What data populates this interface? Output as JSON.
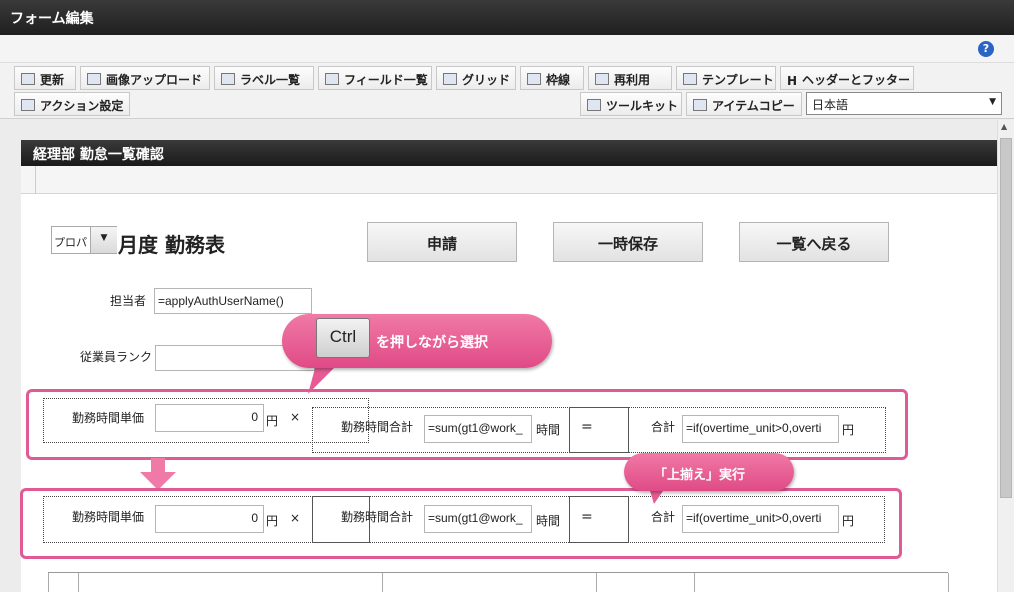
{
  "window": {
    "title": "フォーム編集"
  },
  "help": {
    "icon": "help-icon"
  },
  "toolbar": {
    "row1": [
      {
        "label": "更新",
        "icon": "refresh-icon"
      },
      {
        "label": "画像アップロード",
        "icon": "image-upload-icon"
      },
      {
        "label": "ラベル一覧",
        "icon": "label-list-icon"
      },
      {
        "label": "フィールド一覧",
        "icon": "field-list-icon"
      },
      {
        "label": "グリッド",
        "icon": "grid-icon"
      },
      {
        "label": "枠線",
        "icon": "border-icon"
      },
      {
        "label": "再利用",
        "icon": "reuse-icon"
      },
      {
        "label": "テンプレート",
        "icon": "template-icon"
      },
      {
        "label": "ヘッダーとフッター",
        "icon": "header-footer-icon",
        "glyph": "H"
      }
    ],
    "row2": [
      {
        "label": "アクション設定",
        "icon": "action-settings-icon"
      },
      {
        "label": "ツールキット",
        "icon": "toolkit-icon"
      },
      {
        "label": "アイテムコピー",
        "icon": "item-copy-icon"
      }
    ],
    "language": {
      "value": "日本語",
      "arrow": "▼"
    }
  },
  "form": {
    "header": "経理部 勤怠一覧確認",
    "select_value": "プロパ",
    "select_arrow": "▼",
    "title": "月度 勤務表",
    "buttons": {
      "apply": "申請",
      "save": "一時保存",
      "back": "一覧へ戻る"
    },
    "person_label": "担当者",
    "person_value": "=applyAuthUserName()",
    "rank_label": "従業員ランク",
    "rank_value": "",
    "rows": [
      {
        "unit_label": "勤務時間単価",
        "unit_value": "0",
        "yen": "円",
        "times": "×",
        "total_hours_label": "勤務時間合計",
        "total_hours_value": "=sum(gt1@work_",
        "hours_unit": "時間",
        "equals": "=",
        "total_label": "合計",
        "total_value": "=if(overtime_unit>0,overti",
        "total_unit": "円"
      },
      {
        "unit_label": "勤務時間単価",
        "unit_value": "0",
        "yen": "円",
        "times": "×",
        "total_hours_label": "勤務時間合計",
        "total_hours_value": "=sum(gt1@work_",
        "hours_unit": "時間",
        "equals": "=",
        "total_label": "合計",
        "total_value": "=if(overtime_unit>0,overti",
        "total_unit": "円"
      }
    ]
  },
  "annotations": {
    "ctrl_key": "Ctrl",
    "ctrl_text": "を押しながら選択",
    "align_text": "「上揃え」実行",
    "accent_color": "#e05b95"
  }
}
